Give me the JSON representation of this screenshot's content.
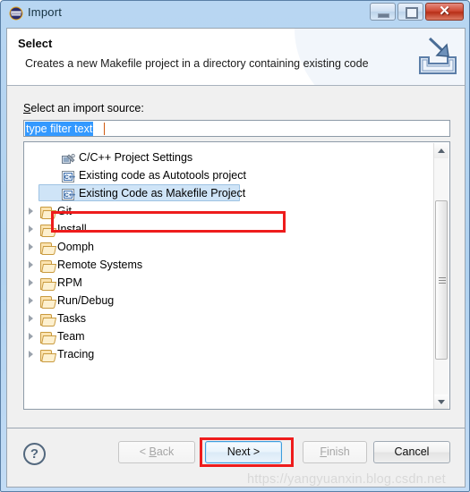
{
  "window": {
    "title": "Import",
    "icon": "eclipse-icon",
    "controls": {
      "minimize": "minimize-icon",
      "maximize": "maximize-icon",
      "close": "✕"
    }
  },
  "banner": {
    "title": "Select",
    "description": "Creates a new Makefile project in a directory containing existing code",
    "icon": "import-wizard-icon"
  },
  "body": {
    "source_label_prefix": "S",
    "source_label": "elect an import source:",
    "filter": {
      "value": "type filter text",
      "placeholder": "type filter text",
      "selected": true
    },
    "tree": [
      {
        "label": "C/C++ Project Settings",
        "icon": "project-settings-icon",
        "indent": 2,
        "expander": false,
        "selected": false
      },
      {
        "label": "Existing code as Autotools project",
        "icon": "cpp-icon",
        "indent": 2,
        "expander": false,
        "selected": false
      },
      {
        "label": "Existing Code as Makefile Project",
        "icon": "cpp-icon",
        "indent": 2,
        "expander": false,
        "selected": true
      },
      {
        "label": "Git",
        "icon": "folder-icon",
        "indent": 1,
        "expander": true,
        "selected": false
      },
      {
        "label": "Install",
        "icon": "folder-icon",
        "indent": 1,
        "expander": true,
        "selected": false
      },
      {
        "label": "Oomph",
        "icon": "folder-icon",
        "indent": 1,
        "expander": true,
        "selected": false
      },
      {
        "label": "Remote Systems",
        "icon": "folder-icon",
        "indent": 1,
        "expander": true,
        "selected": false
      },
      {
        "label": "RPM",
        "icon": "folder-icon",
        "indent": 1,
        "expander": true,
        "selected": false
      },
      {
        "label": "Run/Debug",
        "icon": "folder-icon",
        "indent": 1,
        "expander": true,
        "selected": false
      },
      {
        "label": "Tasks",
        "icon": "folder-icon",
        "indent": 1,
        "expander": true,
        "selected": false
      },
      {
        "label": "Team",
        "icon": "folder-icon",
        "indent": 1,
        "expander": true,
        "selected": false
      },
      {
        "label": "Tracing",
        "icon": "folder-icon",
        "indent": 1,
        "expander": true,
        "selected": false
      }
    ],
    "scrollbar": {
      "up_arrow": "scroll-up-icon",
      "down_arrow": "scroll-down-icon"
    }
  },
  "footer": {
    "help": "?",
    "back": {
      "label": "< Back",
      "prefix": "< ",
      "key": "B",
      "rest": "ack",
      "enabled": false
    },
    "next": {
      "label": "Next >",
      "prefix": "",
      "key": "N",
      "rest": "ext >",
      "enabled": true,
      "focused": true
    },
    "finish": {
      "label": "Finish",
      "prefix": "",
      "key": "F",
      "rest": "inish",
      "enabled": false
    },
    "cancel": {
      "label": "Cancel",
      "enabled": true
    }
  },
  "annotations": {
    "selected_row_highlight": "#ee1c1c",
    "next_button_highlight": "#ee1c1c"
  },
  "watermark": "https://yangyuanxin.blog.csdn.net",
  "colors": {
    "titlebar": "#b4d4f1",
    "selection_blue": "#3399ff",
    "tree_selected_bg": "#cfe4f7",
    "annotation_red": "#ee1c1c",
    "close_red": "#cf4a35"
  }
}
